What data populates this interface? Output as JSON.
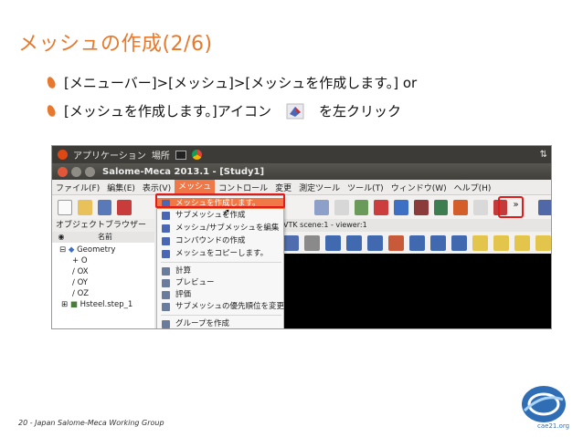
{
  "slide": {
    "title": "メッシュの作成(2/6)",
    "bullet1": "[メニューバー]>[メッシュ]>[メッシュを作成します。] or",
    "bullet2_before": "[メッシュを作成します。]アイコン",
    "bullet2_after": "を左クリック",
    "footer": "20 - Japan Salome-Meca Working Group",
    "logo_text": "cae21.org"
  },
  "ubuntu": {
    "apps": "アプリケーション",
    "places": "場所"
  },
  "window": {
    "title": "Salome-Meca 2013.1 - [Study1]"
  },
  "menubar": [
    "ファイル(F)",
    "編集(E)",
    "表示(V)",
    "メッシュ",
    "コントロール",
    "変更",
    "測定ツール",
    "ツール(T)",
    "ウィンドウ(W)",
    "ヘルプ(H)"
  ],
  "left_panel": {
    "header": "オブジェクトブラウザー",
    "col_name": "名前",
    "tree": [
      "Geometry",
      "O",
      "OX",
      "OY",
      "OZ",
      "Hsteel.step_1"
    ]
  },
  "viewer": {
    "tab": "VTK scene:1 - viewer:1"
  },
  "dropdown": [
    "メッシュを作成します。",
    "サブメッシュを作成",
    "メッシュ/サブメッシュを編集",
    "コンパウンドの作成",
    "メッシュをコピーします。",
    "計算",
    "プレビュー",
    "評価",
    "サブメッシュの優先順位を変更",
    "グループを作成"
  ],
  "colors": {
    "accent": "#e8782c",
    "highlight": "#f07746",
    "callout": "#e21b1b"
  }
}
